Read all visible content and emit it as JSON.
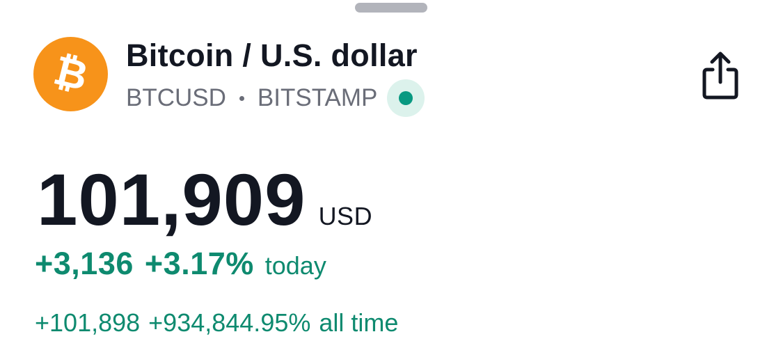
{
  "symbol": {
    "name": "Bitcoin / U.S. dollar",
    "ticker": "BTCUSD",
    "exchange": "BITSTAMP",
    "logo_icon": "bitcoin-logo-icon",
    "logo_glyph": "₿",
    "logo_color": "#f7931a",
    "live_status_color": "#089981"
  },
  "quote": {
    "price": "101,909",
    "currency": "USD"
  },
  "change_today": {
    "value": "+3,136",
    "percent": "+3.17%",
    "label": "today",
    "color": "#0e8a6f"
  },
  "change_all_time": {
    "value": "+101,898",
    "percent": "+934,844.95%",
    "label": "all time"
  },
  "actions": {
    "share_icon": "share-icon"
  }
}
